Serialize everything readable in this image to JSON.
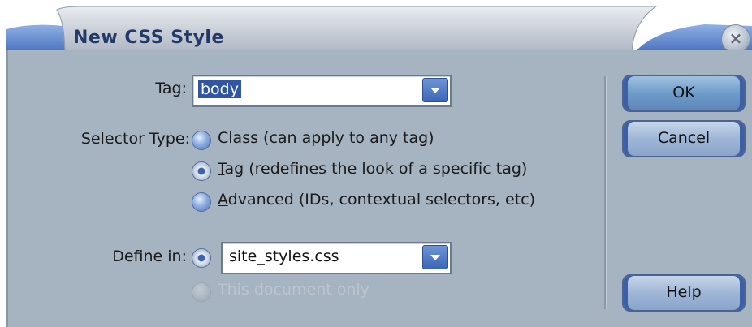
{
  "dialog": {
    "title": "New CSS Style",
    "close_symbol": "×"
  },
  "tag": {
    "label": "Tag:",
    "value": "body"
  },
  "selector_type": {
    "label": "Selector Type:",
    "options": [
      {
        "key": "C",
        "rest": "lass (can apply to any tag)",
        "checked": false
      },
      {
        "key": "T",
        "rest": "ag (redefines the look of a specific tag)",
        "checked": true
      },
      {
        "key": "A",
        "rest": "dvanced (IDs, contextual selectors, etc)",
        "checked": false
      }
    ]
  },
  "define_in": {
    "label": "Define in:",
    "file_value": "site_styles.css",
    "doc_only_label": "This document only"
  },
  "buttons": {
    "ok": "OK",
    "cancel": "Cancel",
    "help": "Help"
  },
  "colors": {
    "panel": "#a6b3c1",
    "title_text": "#223a6a",
    "selection": "#2f55a4"
  }
}
